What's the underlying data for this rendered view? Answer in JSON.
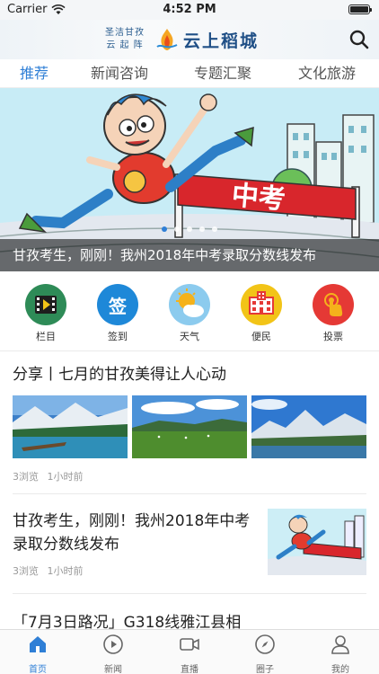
{
  "status_bar": {
    "carrier": "Carrier",
    "time": "4:52 PM",
    "battery_level": 1.0
  },
  "header": {
    "slogan_line1": "圣洁甘孜",
    "slogan_line2": "云 起 阵",
    "logo_text": "云上稻城",
    "search_icon": "search-icon"
  },
  "tabs": [
    {
      "label": "推荐",
      "active": true
    },
    {
      "label": "新闻咨询",
      "active": false
    },
    {
      "label": "专题汇聚",
      "active": false
    },
    {
      "label": "文化旅游",
      "active": false
    }
  ],
  "banner": {
    "caption": "甘孜考生，刚刚！我州2018年中考录取分数线发布",
    "image_text": "中考",
    "dot_count": 5,
    "active_dot": 0
  },
  "quick_links": [
    {
      "label": "栏目",
      "icon": "video-column-icon",
      "color": "#2e8b57"
    },
    {
      "label": "签到",
      "icon": "sign-in-icon",
      "color": "#1e88d8",
      "glyph": "签"
    },
    {
      "label": "天气",
      "icon": "weather-icon",
      "color": "#5ab4e6"
    },
    {
      "label": "便民",
      "icon": "service-icon",
      "color": "#f2c417"
    },
    {
      "label": "投票",
      "icon": "vote-icon",
      "color": "#e53935"
    }
  ],
  "articles": [
    {
      "title": "分享丨七月的甘孜美得让人心动",
      "views": "3浏览",
      "time": "1小时前"
    },
    {
      "title": "甘孜考生，刚刚！我州2018年中考录取分数线发布",
      "views": "3浏览",
      "time": "1小时前"
    },
    {
      "title": "「7月3日路况」G318线雅江县相"
    }
  ],
  "bottom_nav": [
    {
      "label": "首页",
      "icon": "home-icon",
      "active": true
    },
    {
      "label": "新闻",
      "icon": "play-icon",
      "active": false
    },
    {
      "label": "直播",
      "icon": "camera-icon",
      "active": false
    },
    {
      "label": "圈子",
      "icon": "compass-icon",
      "active": false
    },
    {
      "label": "我的",
      "icon": "user-icon",
      "active": false
    }
  ],
  "colors": {
    "accent": "#2f7fd6"
  }
}
